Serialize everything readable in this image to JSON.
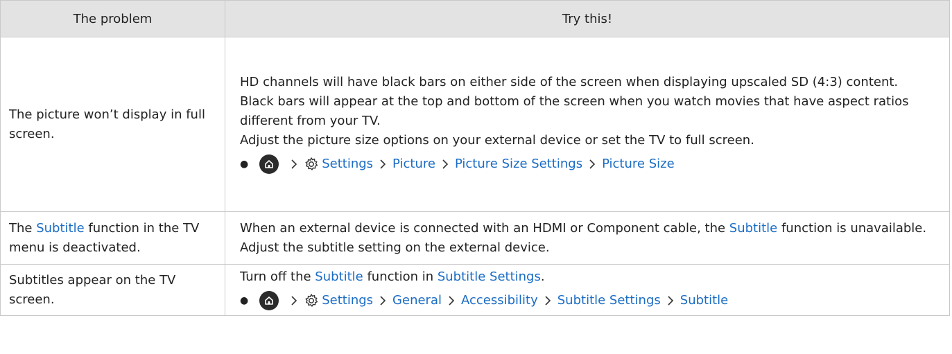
{
  "header": {
    "col1": "The problem",
    "col2": "Try this!"
  },
  "rows": [
    {
      "problem": "The picture won’t display in full screen.",
      "p1": "HD channels will have black bars on either side of the screen when displaying upscaled SD (4:3) content.",
      "p2": "Black bars will appear at the top and bottom of the screen when you watch movies that have aspect ratios different from your TV.",
      "p3": "Adjust the picture size options on your external device or set the TV to full screen.",
      "path": [
        "Settings",
        "Picture",
        "Picture Size Settings",
        "Picture Size"
      ]
    },
    {
      "problem_a": "The ",
      "problem_hl": "Subtitle",
      "problem_b": " function in the TV menu is deactivated.",
      "t_a": "When an external device is connected with an HDMI or Component cable, the ",
      "t_hl": "Subtitle",
      "t_b": " function is unavailable. Adjust the subtitle setting on the external device."
    },
    {
      "problem": "Subtitles appear on the TV screen.",
      "t_a": "Turn off the ",
      "t_hl1": "Subtitle",
      "t_b": " function in ",
      "t_hl2": "Subtitle Settings",
      "t_c": ".",
      "path": [
        "Settings",
        "General",
        "Accessibility",
        "Subtitle Settings",
        "Subtitle"
      ]
    }
  ],
  "colors": {
    "link": "#1a6cc4",
    "header_bg": "#e3e3e3",
    "border": "#c9c9c9"
  },
  "icons": [
    "home-icon",
    "settings-gear-icon",
    "chevron-right-icon",
    "bullet"
  ]
}
